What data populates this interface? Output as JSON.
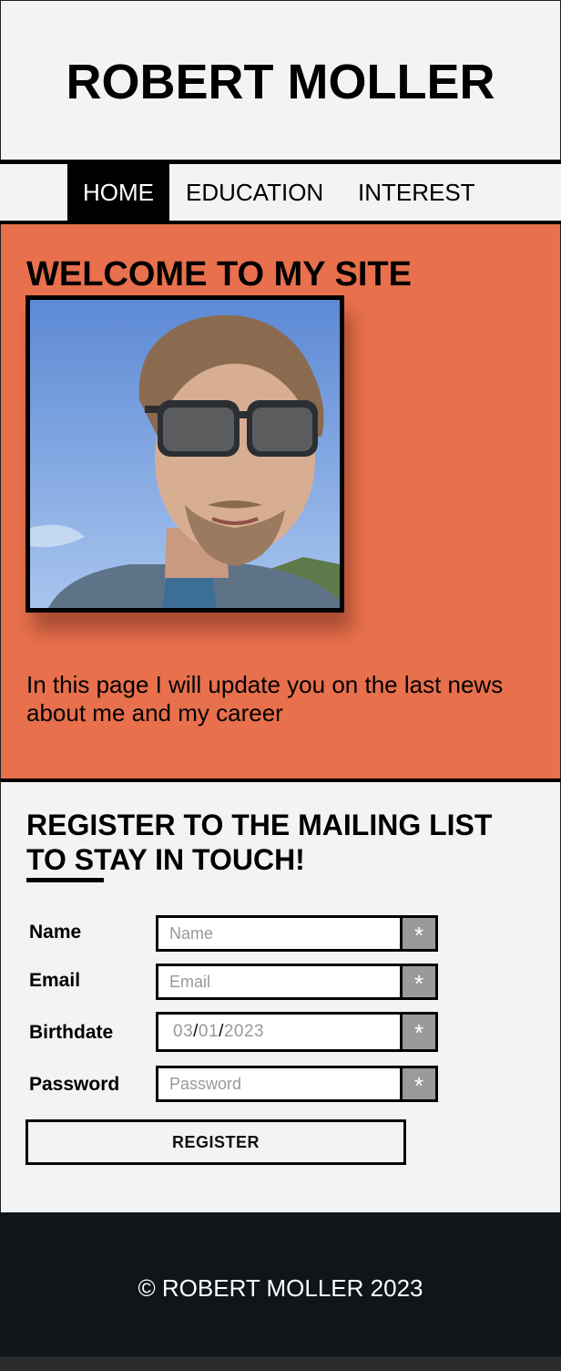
{
  "header": {
    "title": "ROBERT MOLLER"
  },
  "nav": {
    "items": [
      "HOME",
      "EDUCATION",
      "INTEREST"
    ]
  },
  "hero": {
    "heading": "WELCOME TO MY SITE",
    "text": "In this page I will update you on the last news about me and my career"
  },
  "signup": {
    "heading": "REGISTER TO THE MAILING LIST TO STAY IN TOUCH!",
    "name_label": "Name",
    "name_placeholder": "Name",
    "email_label": "Email",
    "email_placeholder": "Email",
    "birthdate_label": "Birthdate",
    "birthdate": {
      "month": "03",
      "day": "01",
      "year": "2023"
    },
    "password_label": "Password",
    "password_placeholder": "Password",
    "required_marker": "*",
    "register_label": "REGISTER"
  },
  "footer": {
    "copyright": "© ROBERT MOLLER 2023"
  },
  "colors": {
    "accent": "#e8704d",
    "footer_bg": "#0f1519",
    "page_bg": "#f3f3f3"
  }
}
